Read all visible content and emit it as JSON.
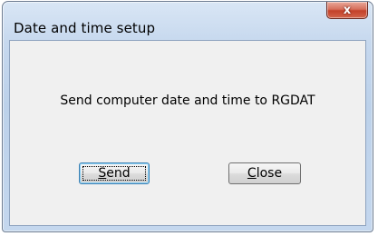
{
  "window": {
    "title": "Date and time setup",
    "close_glyph": "x",
    "close_icon": "close-icon"
  },
  "dialog": {
    "message": "Send computer date and time to RGDAT"
  },
  "buttons": {
    "send": {
      "accel": "S",
      "rest": "end"
    },
    "close": {
      "accel": "C",
      "rest": "lose"
    }
  },
  "colors": {
    "titlebar": "#c6d8ee",
    "close_button": "#c3412a",
    "client_background": "#f0f0f0",
    "default_button_border": "#3c7fb1"
  }
}
